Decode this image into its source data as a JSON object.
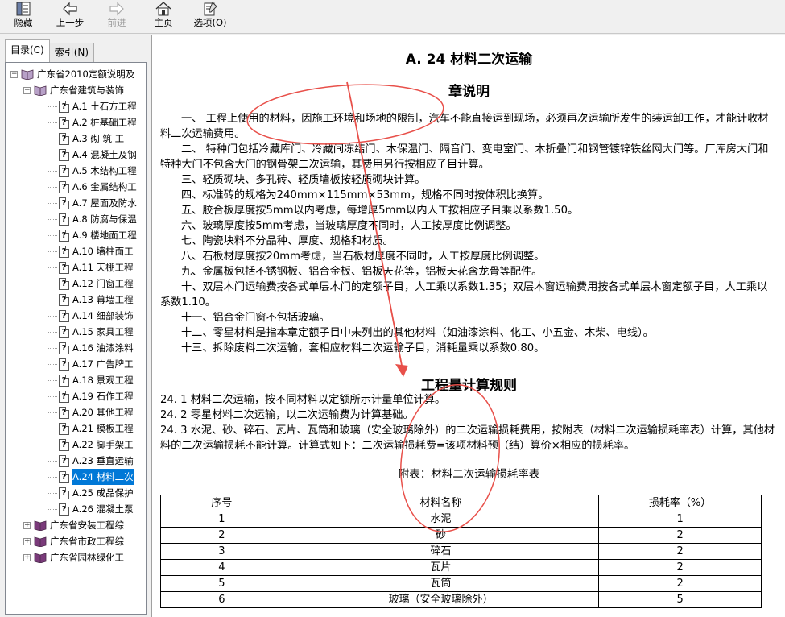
{
  "toolbar": {
    "buttons": [
      {
        "label": "隐藏",
        "icon": "hide-pane-icon",
        "enabled": true
      },
      {
        "label": "上一步",
        "icon": "back-arrow-icon",
        "enabled": true
      },
      {
        "label": "前进",
        "icon": "forward-arrow-icon",
        "enabled": false
      },
      {
        "label": "主页",
        "icon": "home-icon",
        "enabled": true
      },
      {
        "label": "选项(O)",
        "icon": "options-icon",
        "enabled": true
      }
    ]
  },
  "tabs": {
    "contents": "目录(C)",
    "index": "索引(N)"
  },
  "tree": {
    "root": "广东省2010定额说明及",
    "group": "广东省建筑与装饰",
    "items": [
      "A.1  土石方工程",
      "A.2  桩基础工程",
      "A.3  砌  筑  工",
      "A.4  混凝土及钢",
      "A.5  木结构工程",
      "A.6  金属结构工",
      "A.7 屋面及防水",
      "A.8  防腐与保温",
      "A.9  楼地面工程",
      "A.10  墙柱面工",
      "A.11  天棚工程",
      "A.12  门窗工程",
      "A.13  幕墙工程",
      "A.14  细部装饰",
      "A.15  家具工程",
      "A.16  油漆涂料",
      "A.17  广告牌工",
      "A.18 景观工程",
      "A.19 石作工程",
      "A.20  其他工程",
      "A.21  模板工程",
      "A.22  脚手架工",
      "A.23  垂直运输",
      "A.24  材料二次",
      "A.25  成品保护",
      "A.26  混凝土泵"
    ],
    "selected_index": 23,
    "others": [
      "广东省安装工程综",
      "广东省市政工程综",
      "广东省园林绿化工"
    ]
  },
  "doc": {
    "title": "A. 24   材料二次运输",
    "chapter": "章说明",
    "paragraphs": [
      "一、    工程上使用的材料，因施工环境和场地的限制，汽车不能直接运到现场，必须再次运输所发生的装运卸工作，才能计收材料二次运输费用。",
      "二、    特种门包括冷藏库门、冷藏间冻结门、木保温门、隔音门、变电室门、木折叠门和钢管镀锌铁丝网大门等。厂库房大门和特种大门不包含大门的钢骨架二次运输，其费用另行按相应子目计算。",
      "三、轻质砌块、多孔砖、轻质墙板按轻质砌块计算。",
      "四、标准砖的规格为240mm×115mm×53mm，规格不同时按体积比换算。",
      "五、胶合板厚度按5mm以内考虑，每增厚5mm以内人工按相应子目乘以系数1.50。",
      "六、玻璃厚度按5mm考虑，当玻璃厚度不同时，人工按厚度比例调整。",
      "七、陶瓷块料不分品种、厚度、规格和材质。",
      "八、石板材厚度按20mm考虑，当石板材厚度不同时，人工按厚度比例调整。",
      "九、金属板包括不锈钢板、铝合金板、铝板天花等，铝板天花含龙骨等配件。",
      "十、双层木门运输费按各式单层木门的定额子目，人工乘以系数1.35；双层木窗运输费用按各式单层木窗定额子目，人工乘以系数1.10。",
      "十一、铝合金门窗不包括玻璃。",
      "十二、零星材料是指本章定额子目中未列出的其他材料（如油漆涂料、化工、小五金、木柴、电线）。",
      "十三、拆除废料二次运输，套相应材料二次运输子目，消耗量乘以系数0.80。"
    ],
    "rules_title": "工程量计算规则",
    "rules": [
      "24. 1   材料二次运输，按不同材料以定额所示计量单位计算。",
      "24. 2   零星材料二次运输，以二次运输费为计算基础。",
      "24. 3   水泥、砂、碎石、瓦片、瓦筒和玻璃（安全玻璃除外）的二次运输损耗费用，按附表（材料二次运输损耗率表）计算，其他材料的二次运输损耗不能计算。计算式如下：二次运输损耗费=该项材料预（结）算价×相应的损耗率。"
    ],
    "table_caption": "附表：材料二次运输损耗率表",
    "table_headers": [
      "序号",
      "材料名称",
      "损耗率（%）"
    ],
    "table_rows": [
      [
        "1",
        "水泥",
        "1"
      ],
      [
        "2",
        "砂",
        "2"
      ],
      [
        "3",
        "碎石",
        "2"
      ],
      [
        "4",
        "瓦片",
        "2"
      ],
      [
        "5",
        "瓦筒",
        "2"
      ],
      [
        "6",
        "玻璃（安全玻璃除外）",
        "5"
      ]
    ]
  },
  "colors": {
    "annotation": "#e8504a",
    "selection": "#0078d7"
  }
}
